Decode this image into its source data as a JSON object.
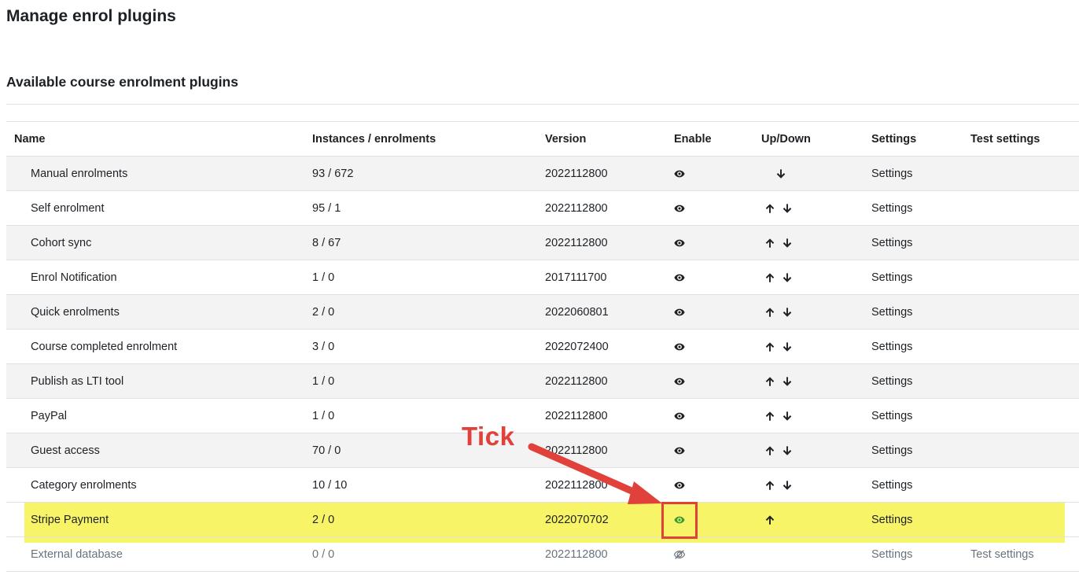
{
  "page": {
    "title": "Manage enrol plugins",
    "section_title": "Available course enrolment plugins"
  },
  "table": {
    "headers": [
      "Name",
      "Instances / enrolments",
      "Version",
      "Enable",
      "Up/Down",
      "Settings",
      "Test settings"
    ],
    "rows": [
      {
        "name": "Manual enrolments",
        "instances": "93 / 672",
        "version": "2022112800",
        "enabled": true,
        "up": false,
        "down": true,
        "settings": "Settings",
        "test": ""
      },
      {
        "name": "Self enrolment",
        "instances": "95 / 1",
        "version": "2022112800",
        "enabled": true,
        "up": true,
        "down": true,
        "settings": "Settings",
        "test": ""
      },
      {
        "name": "Cohort sync",
        "instances": "8 / 67",
        "version": "2022112800",
        "enabled": true,
        "up": true,
        "down": true,
        "settings": "Settings",
        "test": ""
      },
      {
        "name": "Enrol Notification",
        "instances": "1 / 0",
        "version": "2017111700",
        "enabled": true,
        "up": true,
        "down": true,
        "settings": "Settings",
        "test": ""
      },
      {
        "name": "Quick enrolments",
        "instances": "2 / 0",
        "version": "2022060801",
        "enabled": true,
        "up": true,
        "down": true,
        "settings": "Settings",
        "test": ""
      },
      {
        "name": "Course completed enrolment",
        "instances": "3 / 0",
        "version": "2022072400",
        "enabled": true,
        "up": true,
        "down": true,
        "settings": "Settings",
        "test": ""
      },
      {
        "name": "Publish as LTI tool",
        "instances": "1 / 0",
        "version": "2022112800",
        "enabled": true,
        "up": true,
        "down": true,
        "settings": "Settings",
        "test": ""
      },
      {
        "name": "PayPal",
        "instances": "1 / 0",
        "version": "2022112800",
        "enabled": true,
        "up": true,
        "down": true,
        "settings": "Settings",
        "test": ""
      },
      {
        "name": "Guest access",
        "instances": "70 / 0",
        "version": "2022112800",
        "enabled": true,
        "up": true,
        "down": true,
        "settings": "Settings",
        "test": ""
      },
      {
        "name": "Category enrolments",
        "instances": "10 / 10",
        "version": "2022112800",
        "enabled": true,
        "up": true,
        "down": true,
        "settings": "Settings",
        "test": ""
      },
      {
        "name": "Stripe Payment",
        "instances": "2 / 0",
        "version": "2022070702",
        "enabled": true,
        "up": true,
        "down": false,
        "settings": "Settings",
        "test": "",
        "highlight": true
      },
      {
        "name": "External database",
        "instances": "0 / 0",
        "version": "2022112800",
        "enabled": false,
        "up": false,
        "down": false,
        "settings": "Settings",
        "test": "Test settings",
        "disabled": true
      }
    ]
  },
  "annotation": {
    "label": "Tick",
    "color": "#e0413a",
    "highlight_color": "#f7f356"
  },
  "colors": {
    "text": "#1d2125",
    "muted": "#6a737b",
    "stripe": "#f3f3f3",
    "border": "#dee2e6",
    "enabled_green": "#3a9a3a"
  },
  "icons": {
    "enable": "eye-icon",
    "disabled": "eye-slash-icon",
    "up": "arrow-up-icon",
    "down": "arrow-down-icon"
  }
}
